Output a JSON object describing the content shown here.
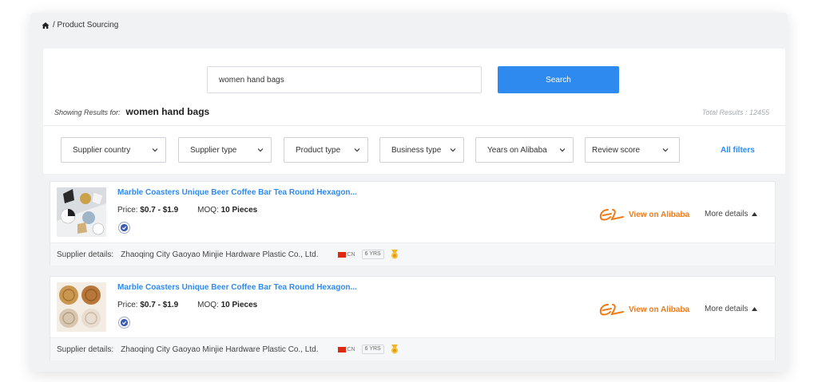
{
  "breadcrumb": {
    "path": "/ Product Sourcing"
  },
  "search": {
    "value": "women hand bags",
    "button_label": "Search"
  },
  "results": {
    "showing_label": "Showing Results for:",
    "query": "women hand bags",
    "total_label": "Total Results : 12455"
  },
  "filters": [
    {
      "label": "Supplier country"
    },
    {
      "label": "Supplier type"
    },
    {
      "label": "Product type"
    },
    {
      "label": "Business type"
    },
    {
      "label": "Years on Alibaba"
    },
    {
      "label": "Review score"
    }
  ],
  "all_filters_label": "All filters",
  "products": [
    {
      "title": "Marble Coasters Unique Beer Coffee Bar Tea Round Hexagon...",
      "price_label": "Price:",
      "price": "$0.7 - $1.9",
      "moq_label": "MOQ:",
      "moq": "10 Pieces",
      "view_label": "View on Alibaba",
      "more_label": "More details",
      "supplier_label": "Supplier details:",
      "supplier_name": "Zhaoqing City Gaoyao Minjie Hardware Plastic Co., Ltd.",
      "country": "CN",
      "years": "6 YRS"
    },
    {
      "title": "Marble Coasters Unique Beer Coffee Bar Tea Round Hexagon...",
      "price_label": "Price:",
      "price": "$0.7 - $1.9",
      "moq_label": "MOQ:",
      "moq": "10 Pieces",
      "view_label": "View on Alibaba",
      "more_label": "More details",
      "supplier_label": "Supplier details:",
      "supplier_name": "Zhaoqing City Gaoyao Minjie Hardware Plastic Co., Ltd.",
      "country": "CN",
      "years": "6 YRS"
    }
  ],
  "colors": {
    "accent": "#2f8af0",
    "alibaba": "#f07a16",
    "background": "#f1f2f4"
  }
}
